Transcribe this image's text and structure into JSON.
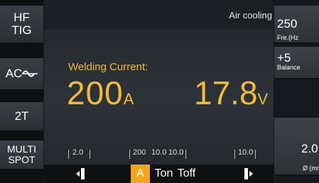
{
  "left_panel": {
    "mode": "HF\nTIG",
    "current_type": "AC",
    "trigger": "2T",
    "spot": "MULTI\nSPOT"
  },
  "status": {
    "cooling": "Air cooling"
  },
  "main": {
    "welding_current_label": "Welding Current:",
    "current_value": "200",
    "current_unit": "A",
    "voltage_value": "17.8",
    "voltage_unit": "V"
  },
  "right_panel": {
    "frequency_value": "250",
    "frequency_label": "Fre.(Hz",
    "balance_value": "+5",
    "balance_label": "Balance",
    "diameter_value": "2.0",
    "diameter_label": "Ø (mm)"
  },
  "params": {
    "pre_flow": "2.0",
    "current": "200",
    "ton": "10.0",
    "toff": "10.0",
    "post_flow": "10.0"
  },
  "bottom": {
    "a_label": "A",
    "ton_label": "Ton",
    "toff_label": "Toff"
  },
  "colors": {
    "accent": "#f2bb3b",
    "selected": "#f2a51f"
  }
}
